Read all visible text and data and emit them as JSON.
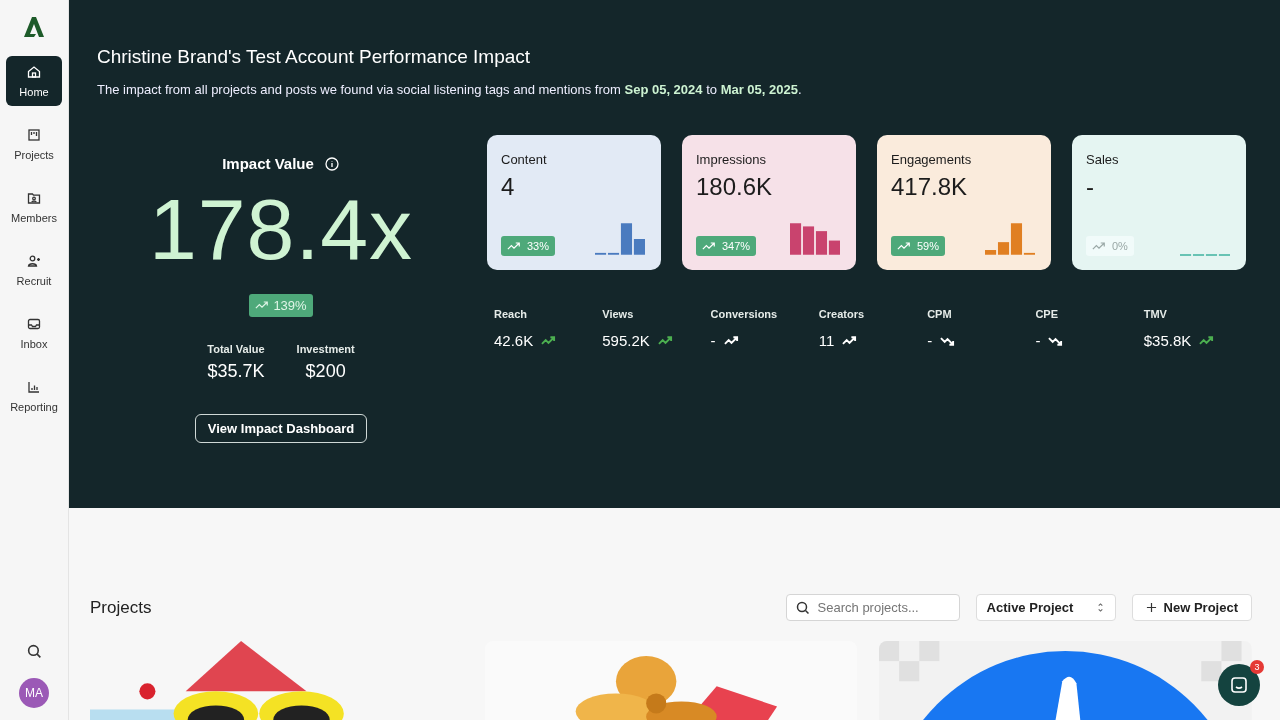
{
  "sidebar": {
    "items": [
      {
        "label": "Home",
        "selected": true
      },
      {
        "label": "Projects",
        "selected": false
      },
      {
        "label": "Members",
        "selected": false
      },
      {
        "label": "Recruit",
        "selected": false
      },
      {
        "label": "Inbox",
        "selected": false
      },
      {
        "label": "Reporting",
        "selected": false
      }
    ],
    "avatar": "MA"
  },
  "hero": {
    "title": "Christine Brand's Test Account Performance Impact",
    "subtitle": "The impact from all projects and posts we found via social listening tags and mentions from **Sep 05, 2024** to **Mar 05, 2025**.",
    "impact": {
      "label": "Impact Value",
      "value": "178.4x",
      "change": "139%",
      "stats": [
        {
          "label": "Total Value",
          "value": "$35.7K"
        },
        {
          "label": "Investment",
          "value": "$200"
        }
      ],
      "button": "View Impact Dashboard"
    },
    "cards": [
      {
        "label": "Content",
        "value": "4",
        "change": "33%",
        "disabled": false,
        "color": "#4a7bbf"
      },
      {
        "label": "Impressions",
        "value": "180.6K",
        "change": "347%",
        "disabled": false,
        "color": "#c9436e"
      },
      {
        "label": "Engagements",
        "value": "417.8K",
        "change": "59%",
        "disabled": false,
        "color": "#e07f22"
      },
      {
        "label": "Sales",
        "value": "-",
        "change": "0%",
        "disabled": true,
        "color": "#5fbfb0"
      }
    ],
    "metrics": [
      {
        "label": "Reach",
        "value": "42.6K",
        "kind": "up",
        "color": "#4caf50"
      },
      {
        "label": "Views",
        "value": "595.2K",
        "kind": "up",
        "color": "#4caf50"
      },
      {
        "label": "Conversions",
        "value": "-",
        "kind": "up",
        "color": "#ffffff"
      },
      {
        "label": "Creators",
        "value": "11",
        "kind": "up",
        "color": "#ffffff"
      },
      {
        "label": "CPM",
        "value": "-",
        "kind": "down",
        "color": "#ffffff"
      },
      {
        "label": "CPE",
        "value": "-",
        "kind": "down",
        "color": "#ffffff"
      },
      {
        "label": "TMV",
        "value": "$35.8K",
        "kind": "up",
        "color": "#4caf50"
      }
    ]
  },
  "projects": {
    "title": "Projects",
    "search": {
      "placeholder": "Search projects..."
    },
    "filter": "Active Project",
    "new_button": "New Project"
  },
  "chat": {
    "badge": "3"
  }
}
